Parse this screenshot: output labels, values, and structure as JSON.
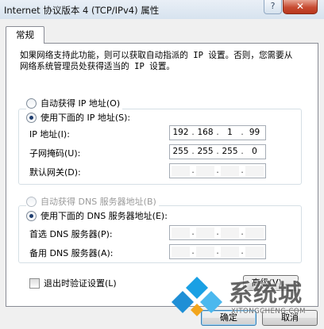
{
  "window": {
    "title": "Internet 协议版本 4 (TCP/IPv4) 属性",
    "help_glyph": "?",
    "close_glyph": "✕"
  },
  "tabs": [
    {
      "label": "常规",
      "selected": true
    }
  ],
  "description": "如果网络支持此功能，则可以获取自动指派的 IP 设置。否则，您需要从网络系统管理员处获得适当的 IP 设置。",
  "ip_section": {
    "auto_label": "自动获得 IP 地址(O)",
    "manual_label": "使用下面的 IP 地址(S):",
    "selected": "manual",
    "ip_address": {
      "label": "IP 地址(I):",
      "octets": [
        "192",
        "168",
        "1",
        "99"
      ]
    },
    "subnet_mask": {
      "label": "子网掩码(U):",
      "octets": [
        "255",
        "255",
        "255",
        "0"
      ]
    },
    "default_gateway": {
      "label": "默认网关(D):",
      "octets": [
        "",
        "",
        "",
        ""
      ]
    }
  },
  "dns_section": {
    "auto_label": "自动获得 DNS 服务器地址(B)",
    "manual_label": "使用下面的 DNS 服务器地址(E):",
    "selected": "manual",
    "auto_disabled": true,
    "preferred": {
      "label": "首选 DNS 服务器(P):",
      "octets": [
        "",
        "",
        "",
        ""
      ]
    },
    "alternate": {
      "label": "备用 DNS 服务器(A):",
      "octets": [
        "",
        "",
        "",
        ""
      ]
    }
  },
  "validate_on_exit": {
    "label": "退出时验证设置(L)",
    "checked": false
  },
  "buttons": {
    "advanced": "高级(V)...",
    "ok": "确定",
    "cancel": "取消"
  },
  "watermark": {
    "brand": "系统城",
    "url": "XITONGCHENG.COM"
  },
  "colors": {
    "title_bar": "#dbe6f1",
    "close_button": "#c74b31",
    "watermark_blue": "#1a9ae0"
  }
}
